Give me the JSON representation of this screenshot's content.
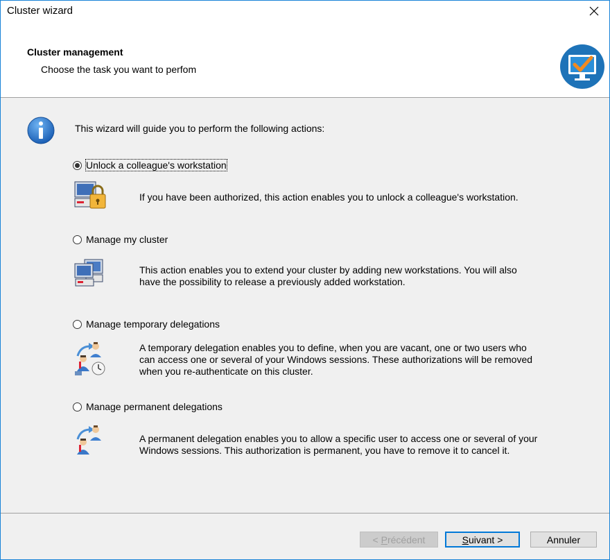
{
  "window": {
    "title": "Cluster wizard",
    "close_glyph": "✕"
  },
  "header": {
    "title": "Cluster management",
    "subtitle": "Choose the task you want to perfom",
    "icon": "monitor-checkmark-icon"
  },
  "intro": {
    "text": "This wizard will guide you to perform the following actions:",
    "icon": "info-icon"
  },
  "options": [
    {
      "label": "Unlock a colleague's workstation",
      "selected": true,
      "icon": "workstation-lock-icon",
      "description": "If you have been authorized, this action enables you to unlock a colleague's workstation."
    },
    {
      "label": "Manage my cluster",
      "selected": false,
      "icon": "workstations-cluster-icon",
      "description_lines": [
        "This action enables you to extend your cluster by adding new workstations. You will also",
        "have the possibility to release a previously added workstation."
      ]
    },
    {
      "label": "Manage temporary delegations",
      "selected": false,
      "icon": "temporary-delegation-icon",
      "description_lines": [
        "A temporary delegation enables you to define, when you are vacant, one or two users who",
        "can access one or several of your Windows sessions. These authorizations will be removed",
        "when you re-authenticate on this cluster."
      ]
    },
    {
      "label": "Manage permanent delegations",
      "selected": false,
      "icon": "permanent-delegation-icon",
      "description_lines": [
        "A permanent delegation enables you to allow a specific user to access one or several of your",
        "Windows sessions. This authorization is permanent, you have to remove it to cancel it."
      ]
    }
  ],
  "buttons": {
    "previous": {
      "prefix": "< ",
      "mnemonic": "P",
      "rest": "récédent",
      "enabled": false
    },
    "next": {
      "mnemonic": "S",
      "rest": "uivant >",
      "enabled": true
    },
    "cancel": {
      "label": "Annuler",
      "enabled": true
    }
  },
  "colors": {
    "accent": "#0078d7",
    "window_border": "#1883d7",
    "dialog_bg": "#f0f0f0",
    "header_bg": "#ffffff",
    "checkmark": "#f28a1f"
  }
}
